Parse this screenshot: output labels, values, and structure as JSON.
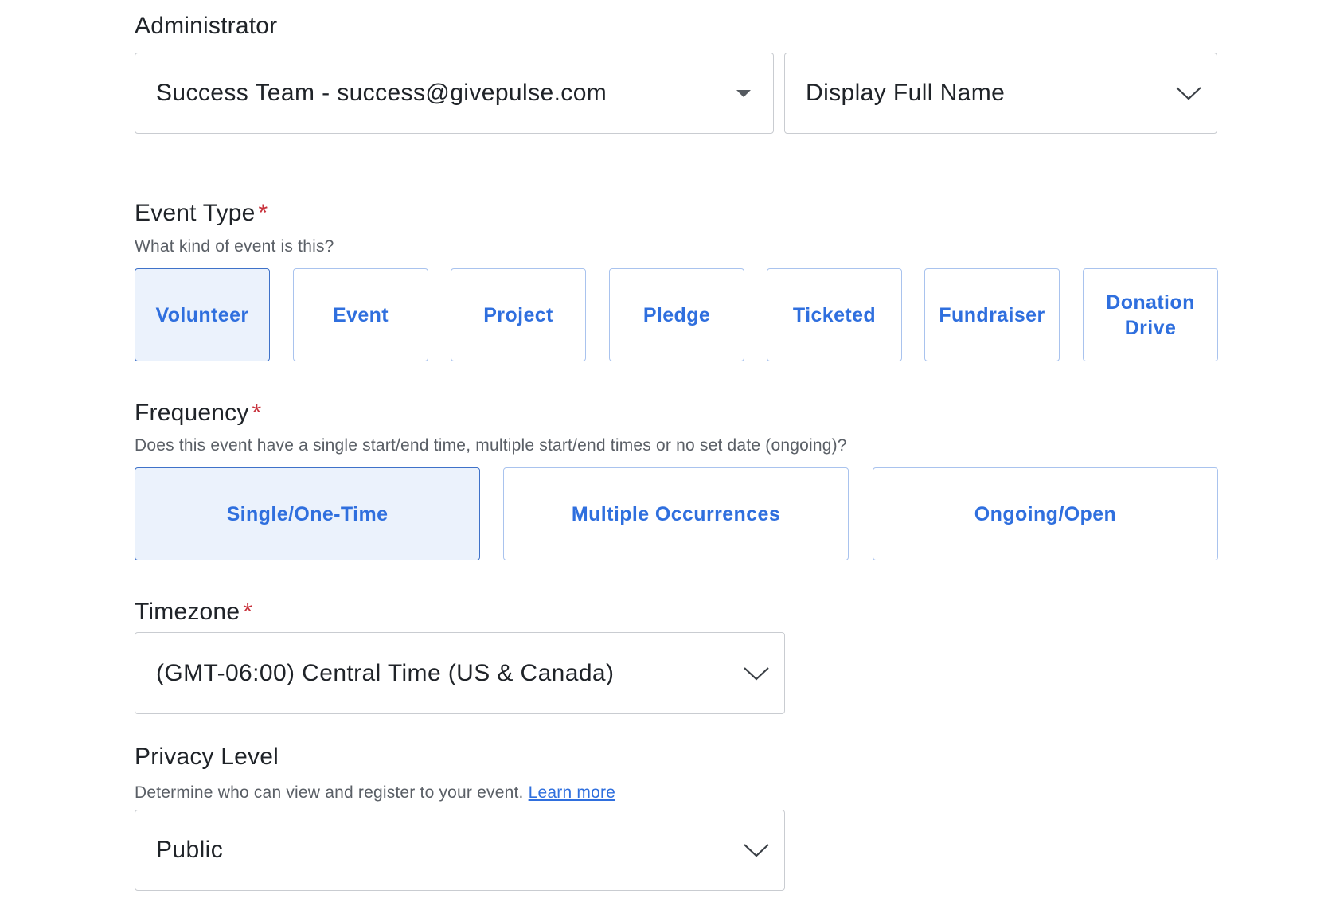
{
  "administrator": {
    "label": "Administrator",
    "selected_admin": "Success Team - success@givepulse.com",
    "display_option": "Display Full Name"
  },
  "event_type": {
    "label": "Event Type",
    "required_mark": "*",
    "help": "What kind of event is this?",
    "options": [
      "Volunteer",
      "Event",
      "Project",
      "Pledge",
      "Ticketed",
      "Fundraiser",
      "Donation Drive"
    ],
    "selected": "Volunteer"
  },
  "frequency": {
    "label": "Frequency",
    "required_mark": "*",
    "help": "Does this event have a single start/end time, multiple start/end times or no set date (ongoing)?",
    "options": [
      "Single/One-Time",
      "Multiple Occurrences",
      "Ongoing/Open"
    ],
    "selected": "Single/One-Time"
  },
  "timezone": {
    "label": "Timezone",
    "required_mark": "*",
    "value": "(GMT-06:00) Central Time (US & Canada)"
  },
  "privacy": {
    "label": "Privacy Level",
    "help": "Determine who can view and register to your event.",
    "learn_more": "Learn more",
    "value": "Public"
  },
  "colors": {
    "accent": "#2f6fde",
    "selected_bg": "#ebf2fc",
    "required": "#c8323c"
  }
}
